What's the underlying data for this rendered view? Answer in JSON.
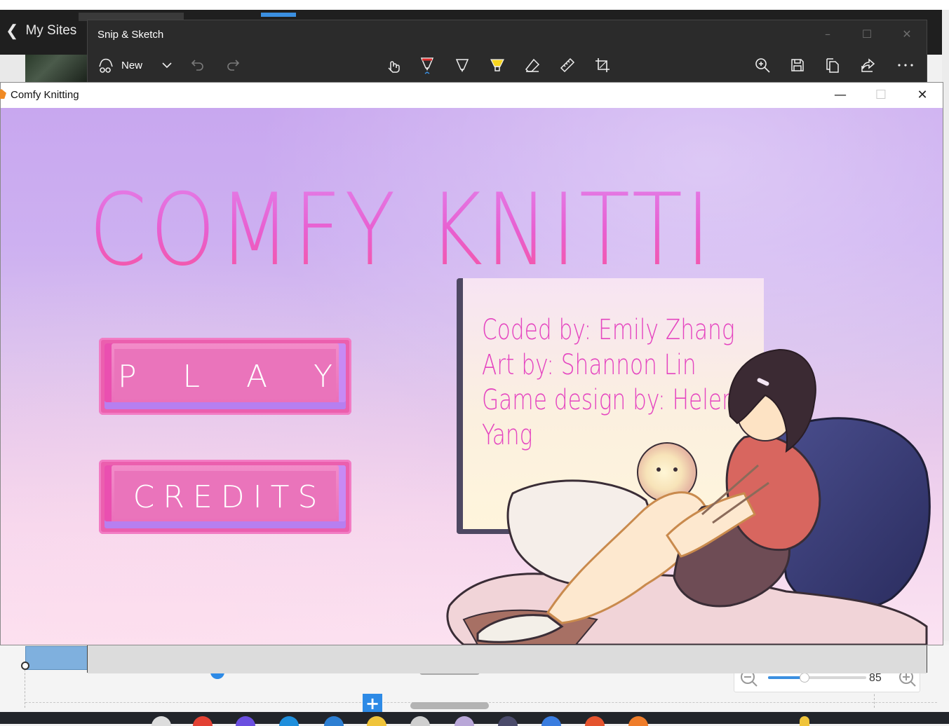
{
  "background_app": {
    "back_label": "My Sites",
    "zoom_value": "85",
    "zoom_fraction": 0.37
  },
  "snip_sketch": {
    "title": "Snip & Sketch",
    "new_label": "New"
  },
  "comfy_window": {
    "title": "Comfy Knitting"
  },
  "game": {
    "title": "COMFY KNITTING",
    "buttons": {
      "play": "P L A Y",
      "credits": "CREDITS"
    },
    "credits_lines": [
      "Coded by: Emily Zhang",
      "Art by: Shannon Lin",
      "Game design by: Helena",
      "Yang"
    ]
  },
  "colors": {
    "title_pink": "#e85fd0",
    "button_pink": "#eb5fae",
    "credits_text": "#e545c0",
    "snip_bg": "#2b2b2b"
  }
}
